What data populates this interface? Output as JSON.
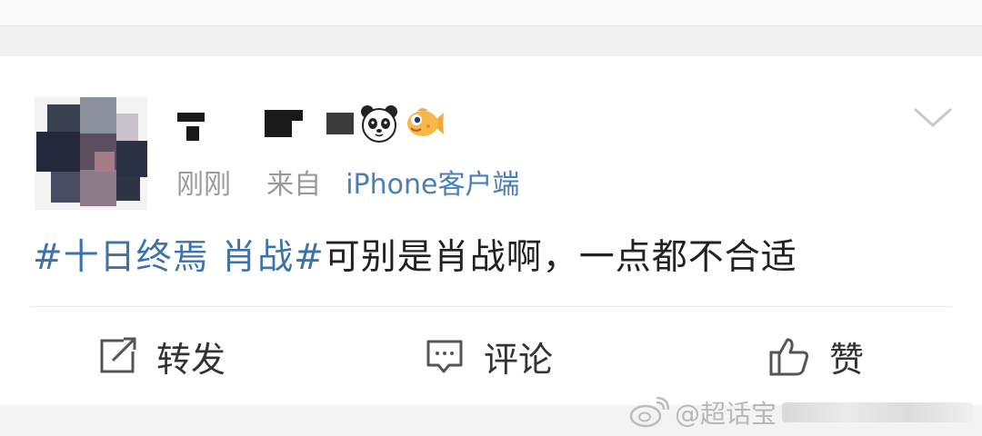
{
  "post": {
    "meta": {
      "time": "刚刚",
      "from_prefix": "来自",
      "source": "iPhone客户端"
    },
    "content": {
      "hashtag": "#十日终焉 肖战#",
      "text": "可别是肖战啊，一点都不合适"
    },
    "icons": [
      "panda-emoji-icon",
      "fish-emoji-icon",
      "chevron-down-icon",
      "repost-icon",
      "comment-icon",
      "like-icon"
    ]
  },
  "actions": {
    "repost_label": "转发",
    "comment_label": "评论",
    "like_label": "赞"
  },
  "watermark": {
    "text": "@超话宝"
  },
  "colors": {
    "link": "#3d73a8",
    "meta_gray": "#9a9a9a",
    "background": "#f1f1f1"
  }
}
